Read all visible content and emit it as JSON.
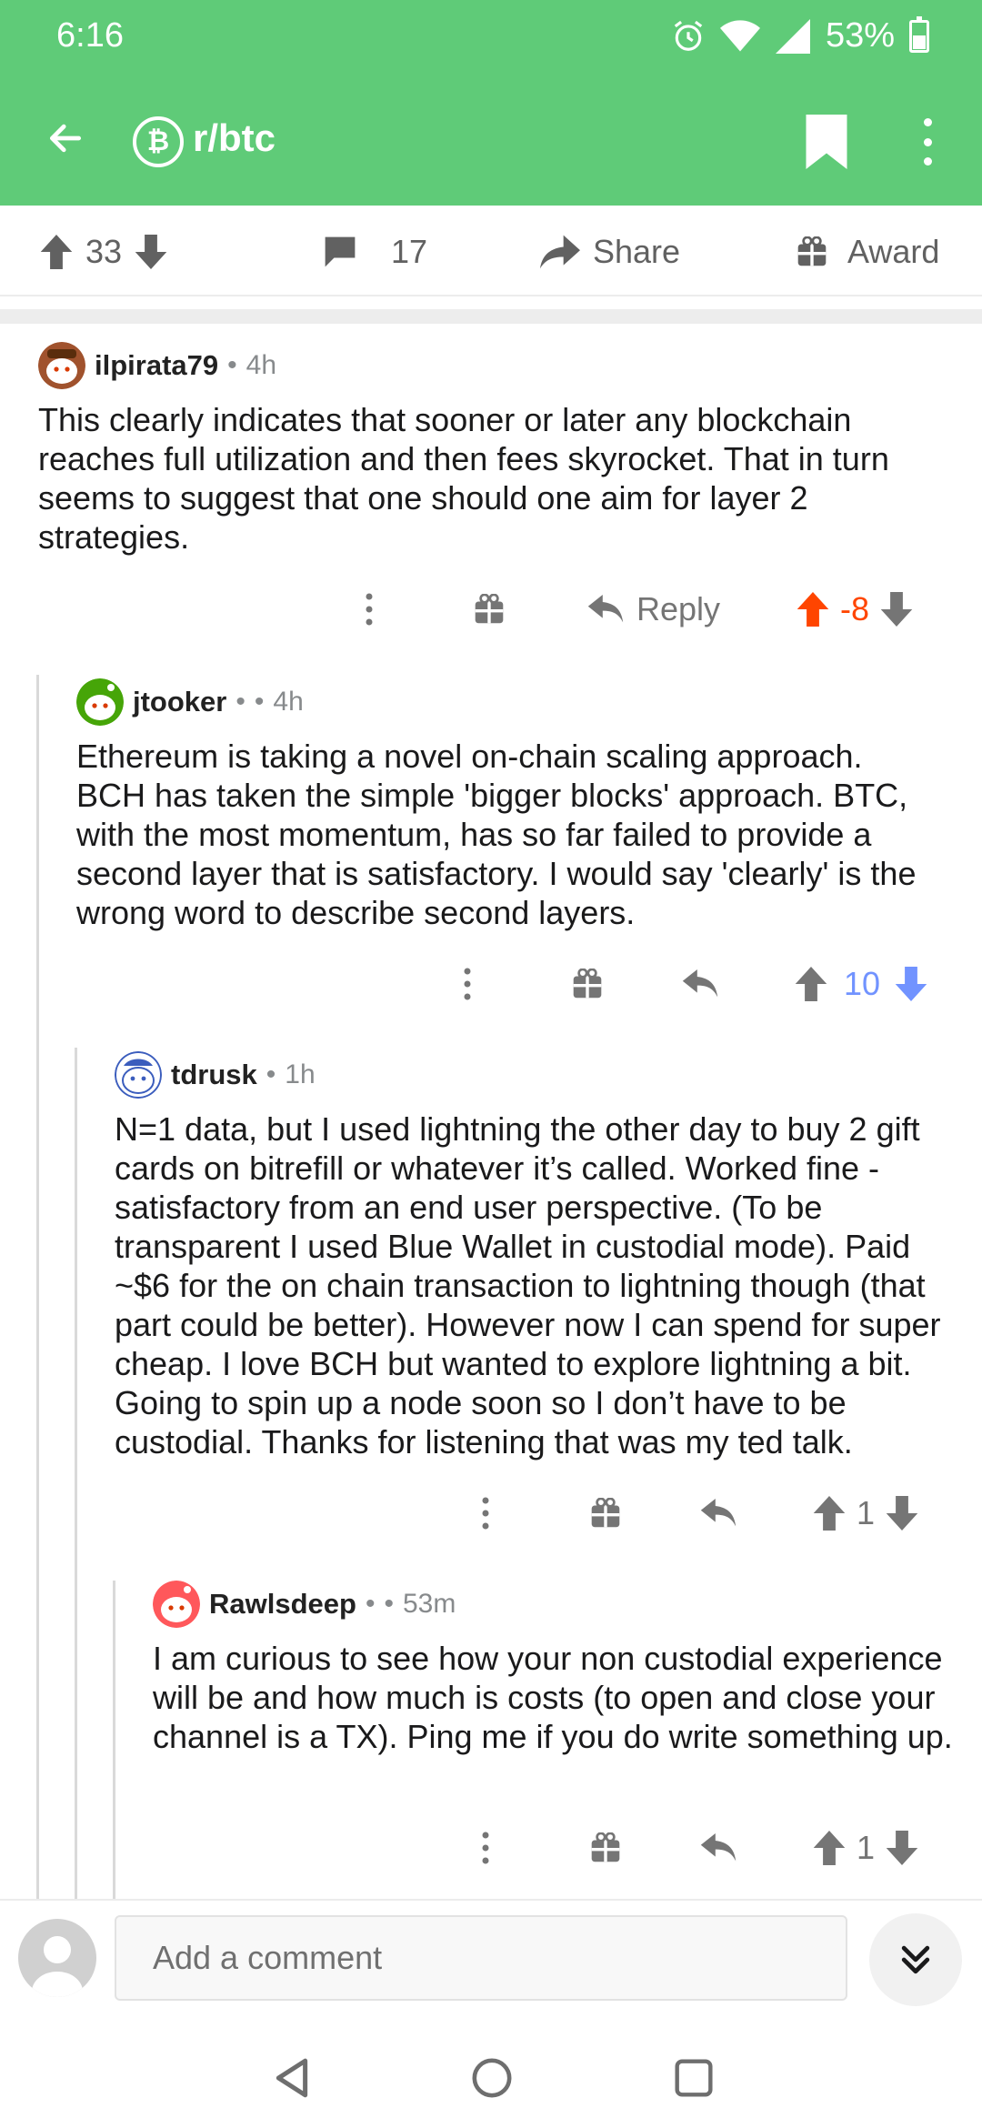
{
  "status_bar": {
    "time": "6:16",
    "battery": "53%"
  },
  "header": {
    "subreddit": "r/btc",
    "subreddit_icon_glyph": "₿"
  },
  "post_actions": {
    "upvotes": "33",
    "comments": "17",
    "share_label": "Share",
    "award_label": "Award"
  },
  "comments": [
    {
      "username": "ilpirata79",
      "time": "4h",
      "body": "This clearly indicates that sooner or later any blockchain reaches full utilization and then fees skyrocket. That in turn seems to suggest that one should one aim for layer 2 strategies.",
      "reply_label": "Reply",
      "score": "-8",
      "vote_state": "upvoted"
    },
    {
      "username": "jtooker",
      "time": "4h",
      "body": "Ethereum is taking a novel on-chain scaling approach.  BCH has taken the simple 'bigger blocks' approach.  BTC, with the most momentum, has so far failed to provide a second layer that is satisfactory.  I would say 'clearly' is the wrong word to describe second layers.",
      "score": "10",
      "vote_state": "downvoted"
    },
    {
      "username": "tdrusk",
      "time": "1h",
      "body": "N=1 data, but I used lightning the other day to buy 2 gift cards on bitrefill or whatever it’s called. Worked fine - satisfactory from an end user perspective. (To be transparent I used Blue Wallet in custodial mode). Paid ~$6 for the on chain transaction to lightning though (that part could be better). However now I can spend for super cheap. I love BCH but wanted to explore lightning a bit. Going to spin up a node soon so I don’t have to be custodial. Thanks for listening that was my ted talk.",
      "score": "1",
      "vote_state": "none"
    },
    {
      "username": "Rawlsdeep",
      "time": "53m",
      "body": "I am curious to see how your non custodial experience will be and how much is costs (to open and close your channel is a TX). Ping me if you do write something up.",
      "score": "1",
      "vote_state": "none"
    }
  ],
  "comment_bar": {
    "placeholder": "Add a comment"
  },
  "colors": {
    "brand_green": "#5fcb78",
    "upvote_orange": "#ff4500",
    "downvote_blue": "#7193ff",
    "meta_gray": "#878a8c"
  }
}
